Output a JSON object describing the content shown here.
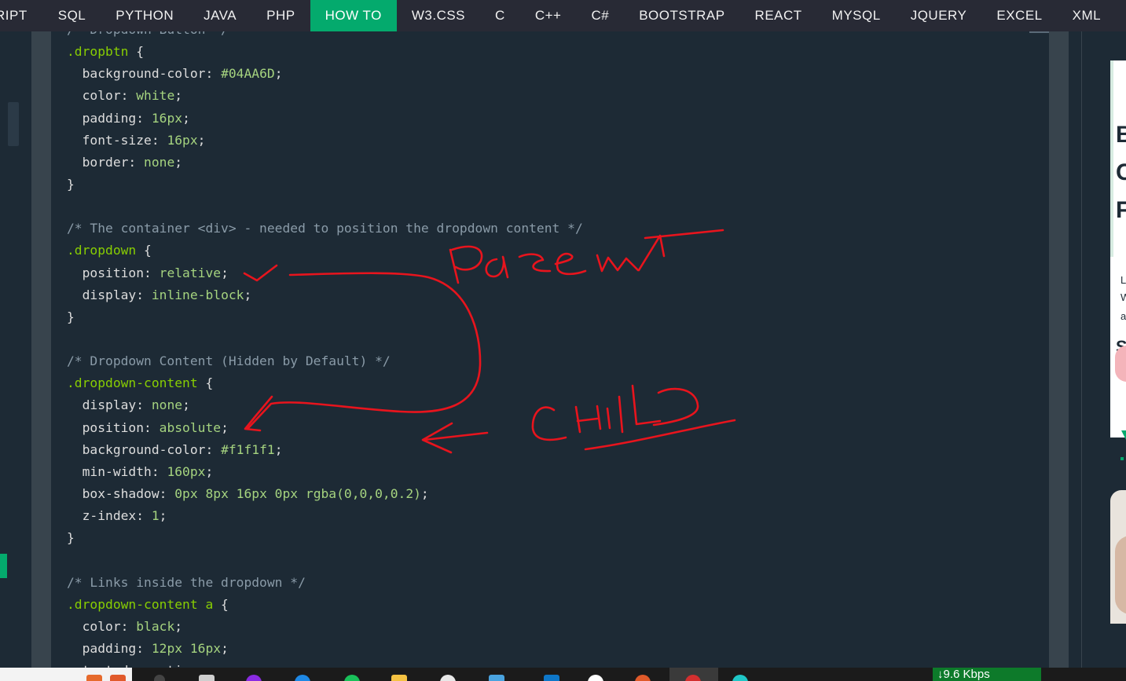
{
  "nav": {
    "items": [
      {
        "label": "RIPT",
        "active": false
      },
      {
        "label": "SQL",
        "active": false
      },
      {
        "label": "PYTHON",
        "active": false
      },
      {
        "label": "JAVA",
        "active": false
      },
      {
        "label": "PHP",
        "active": false
      },
      {
        "label": "HOW TO",
        "active": true
      },
      {
        "label": "W3.CSS",
        "active": false
      },
      {
        "label": "C",
        "active": false
      },
      {
        "label": "C++",
        "active": false
      },
      {
        "label": "C#",
        "active": false
      },
      {
        "label": "BOOTSTRAP",
        "active": false
      },
      {
        "label": "REACT",
        "active": false
      },
      {
        "label": "MYSQL",
        "active": false
      },
      {
        "label": "JQUERY",
        "active": false
      },
      {
        "label": "EXCEL",
        "active": false
      },
      {
        "label": "XML",
        "active": false
      }
    ]
  },
  "code": {
    "lines": [
      [
        {
          "t": "/* Dropdown Button */",
          "c": "com"
        }
      ],
      [
        {
          "t": ".dropbtn",
          "c": "sel"
        },
        {
          "t": " {",
          "c": "prop"
        }
      ],
      [
        {
          "t": "  background-color",
          "c": "prop"
        },
        {
          "t": ": ",
          "c": "prop"
        },
        {
          "t": "#04AA6D",
          "c": "val"
        },
        {
          "t": ";",
          "c": "prop"
        }
      ],
      [
        {
          "t": "  color",
          "c": "prop"
        },
        {
          "t": ": ",
          "c": "prop"
        },
        {
          "t": "white",
          "c": "val"
        },
        {
          "t": ";",
          "c": "prop"
        }
      ],
      [
        {
          "t": "  padding",
          "c": "prop"
        },
        {
          "t": ": ",
          "c": "prop"
        },
        {
          "t": "16px",
          "c": "val"
        },
        {
          "t": ";",
          "c": "prop"
        }
      ],
      [
        {
          "t": "  font-size",
          "c": "prop"
        },
        {
          "t": ": ",
          "c": "prop"
        },
        {
          "t": "16px",
          "c": "val"
        },
        {
          "t": ";",
          "c": "prop"
        }
      ],
      [
        {
          "t": "  border",
          "c": "prop"
        },
        {
          "t": ": ",
          "c": "prop"
        },
        {
          "t": "none",
          "c": "val"
        },
        {
          "t": ";",
          "c": "prop"
        }
      ],
      [
        {
          "t": "}",
          "c": "prop"
        }
      ],
      [],
      [
        {
          "t": "/* The container <div> - needed to position the dropdown content */",
          "c": "com"
        }
      ],
      [
        {
          "t": ".dropdown",
          "c": "sel"
        },
        {
          "t": " {",
          "c": "prop"
        }
      ],
      [
        {
          "t": "  position",
          "c": "prop"
        },
        {
          "t": ": ",
          "c": "prop"
        },
        {
          "t": "relative",
          "c": "val"
        },
        {
          "t": ";",
          "c": "prop"
        }
      ],
      [
        {
          "t": "  display",
          "c": "prop"
        },
        {
          "t": ": ",
          "c": "prop"
        },
        {
          "t": "inline-block",
          "c": "val"
        },
        {
          "t": ";",
          "c": "prop"
        }
      ],
      [
        {
          "t": "}",
          "c": "prop"
        }
      ],
      [],
      [
        {
          "t": "/* Dropdown Content (Hidden by Default) */",
          "c": "com"
        }
      ],
      [
        {
          "t": ".dropdown-content",
          "c": "sel"
        },
        {
          "t": " {",
          "c": "prop"
        }
      ],
      [
        {
          "t": "  display",
          "c": "prop"
        },
        {
          "t": ": ",
          "c": "prop"
        },
        {
          "t": "none",
          "c": "val"
        },
        {
          "t": ";",
          "c": "prop"
        }
      ],
      [
        {
          "t": "  position",
          "c": "prop"
        },
        {
          "t": ": ",
          "c": "prop"
        },
        {
          "t": "absolute",
          "c": "val"
        },
        {
          "t": ";",
          "c": "prop"
        }
      ],
      [
        {
          "t": "  background-color",
          "c": "prop"
        },
        {
          "t": ": ",
          "c": "prop"
        },
        {
          "t": "#f1f1f1",
          "c": "val"
        },
        {
          "t": ";",
          "c": "prop"
        }
      ],
      [
        {
          "t": "  min-width",
          "c": "prop"
        },
        {
          "t": ": ",
          "c": "prop"
        },
        {
          "t": "160px",
          "c": "val"
        },
        {
          "t": ";",
          "c": "prop"
        }
      ],
      [
        {
          "t": "  box-shadow",
          "c": "prop"
        },
        {
          "t": ": ",
          "c": "prop"
        },
        {
          "t": "0px 8px 16px 0px rgba(0,0,0,0.2)",
          "c": "val"
        },
        {
          "t": ";",
          "c": "prop"
        }
      ],
      [
        {
          "t": "  z-index",
          "c": "prop"
        },
        {
          "t": ": ",
          "c": "prop"
        },
        {
          "t": "1",
          "c": "val"
        },
        {
          "t": ";",
          "c": "prop"
        }
      ],
      [
        {
          "t": "}",
          "c": "prop"
        }
      ],
      [],
      [
        {
          "t": "/* Links inside the dropdown */",
          "c": "com"
        }
      ],
      [
        {
          "t": ".dropdown-content a",
          "c": "sel"
        },
        {
          "t": " {",
          "c": "prop"
        }
      ],
      [
        {
          "t": "  color",
          "c": "prop"
        },
        {
          "t": ": ",
          "c": "prop"
        },
        {
          "t": "black",
          "c": "val"
        },
        {
          "t": ";",
          "c": "prop"
        }
      ],
      [
        {
          "t": "  padding",
          "c": "prop"
        },
        {
          "t": ": ",
          "c": "prop"
        },
        {
          "t": "12px 16px",
          "c": "val"
        },
        {
          "t": ";",
          "c": "prop"
        }
      ],
      [
        {
          "t": "  text-decoration",
          "c": "prop"
        },
        {
          "t": ": ",
          "c": "prop"
        },
        {
          "t": "none",
          "c": "val"
        },
        {
          "t": ";",
          "c": "prop"
        }
      ]
    ]
  },
  "ad": {
    "letters": [
      "B",
      "C",
      "F"
    ],
    "small_letters": [
      "L",
      "W",
      "a"
    ],
    "letter_s": "S"
  },
  "taskbar": {
    "net_speed": "↓9.6 Kbps"
  },
  "colors": {
    "accent": "#04aa6d",
    "annotation": "#e8141d",
    "nav_bg": "#282a35",
    "code_bg": "#1d2a35"
  }
}
